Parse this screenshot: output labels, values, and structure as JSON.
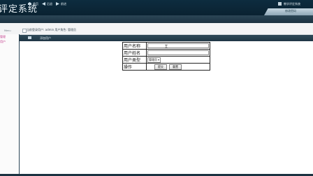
{
  "header": {
    "title": "评定系统",
    "password_tab": "修改密码"
  },
  "nav": {
    "home": "首页",
    "back": "后退",
    "forward": "前进",
    "right_text": "教学评定系统"
  },
  "infobar": {
    "left_label": "Menu",
    "text": "当前登录用户: admin 用户角色: 管理员"
  },
  "sidebar": {
    "items": [
      {
        "label": "管理"
      },
      {
        "label": "用户"
      }
    ]
  },
  "main": {
    "header_text": "添加用户"
  },
  "form": {
    "rows": [
      {
        "label": "用户名称",
        "value": "",
        "placeholder": ""
      },
      {
        "label": "用户姓名",
        "value": "",
        "placeholder": ""
      }
    ],
    "type_label": "用户类型",
    "type_selected": "管理员",
    "action_label": "操作",
    "submit_label": "提交",
    "reset_label": "重置"
  },
  "colors": {
    "banner": "#0d2c3f",
    "navbar": "#1b3241",
    "sidebar_link": "#c0398a"
  }
}
